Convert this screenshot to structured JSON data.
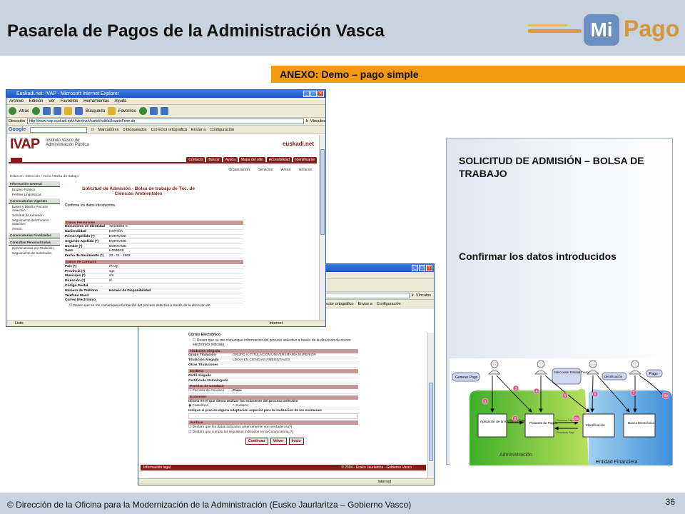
{
  "slide": {
    "title": "Pasarela de Pagos de la Administración Vasca",
    "logo": {
      "mi": "Mi",
      "pago": "Pago"
    },
    "annex": "ANEXO: Demo – pago simple",
    "footer": "© Dirección de la Oficina para la Modernización de la Administración (Eusko Jaurlaritza – Gobierno Vasco)",
    "page_number": "36"
  },
  "panel": {
    "heading": "SOLICITUD DE ADMISIÓN – BOLSA DE TRABAJO",
    "subheading": "Confirmar los datos introducidos"
  },
  "diagram": {
    "roles": [
      "Generar Pago",
      "Seleccionar Entidad Financiera",
      "Identificación",
      "Pago"
    ],
    "nodes": [
      "Aplicación de la Administración",
      "Pasarela de Pagos",
      "Identificación",
      "Banca Electrónica"
    ],
    "steps": [
      "1",
      "2",
      "3",
      "4",
      "5",
      "6",
      "7",
      "8a",
      "8b"
    ],
    "arrows": [
      "Solicitar Pago",
      "Presentar Pago",
      "Resultado Pago"
    ],
    "regions": [
      "Administración",
      "Entidad Financiera"
    ]
  },
  "browser_front": {
    "title": "Euskadi.net: IVAP - Microsoft Internet Explorer",
    "menu": [
      "Archivo",
      "Edición",
      "Ver",
      "Favoritos",
      "Herramientas",
      "Ayuda"
    ],
    "toolbar": [
      "Atrás",
      "Búsqueda",
      "Favoritos"
    ],
    "address_label": "Dirección",
    "address": "http://www.ivap.euskadi.net/r/ivtrebvr/r/cartel/validaUsuarioForm.do",
    "go": "Ir",
    "links": "Vínculos",
    "google_items": [
      "Google",
      "Ir",
      "Marcadores",
      "0 bloqueados",
      "Corrector ortográfico",
      "Enviar a",
      "Configuración"
    ],
    "org_name": "Instituto Vasco de Administración Pública",
    "org_logo": "IVAP",
    "site_logo": "euskadi.net",
    "nav_tabs": [
      "Contacto",
      "Buscar",
      "Ayuda",
      "Mapa del sitio",
      "Accesibilidad",
      "Identificarse"
    ],
    "sub_nav": [
      "Organización",
      "Servicios",
      "Áreas",
      "Enlaces"
    ],
    "breadcrumb": "Estás en: Selección / Inicio / Bolsa de trabajo",
    "sidebar": [
      {
        "head": "Información General",
        "items": [
          "Empleo Público",
          "Perfiles Lingüísticos"
        ]
      },
      {
        "head": "Convocatorias Vigentes",
        "items": [
          "Bases y Diseño Proceso Selectivo",
          "Solicitud de Admisión",
          "Seguimiento del Proceso Selectivo",
          "Avisos"
        ]
      },
      {
        "head": "Convocatorias Finalizadas",
        "items": []
      },
      {
        "head": "Consultas Personalizadas",
        "items": [
          "Convocatorias por Titulación",
          "Seguimiento de Solicitudes"
        ]
      }
    ],
    "form_title": "Solicitud de Admisión - Bolsa de trabajo de Téc. de Ciencias Ambientales",
    "confirm": "Confirme los datos introducidos.",
    "sections": [
      {
        "name": "Datos Personales",
        "rows": [
          [
            "Documento de Identidad",
            "72436950 S"
          ],
          [
            "Nacionalidad",
            "ESPAÑA"
          ],
          [
            "Primer Apellido (*)",
            "BORRAME"
          ],
          [
            "Segundo Apellido (*)",
            "BORRAME"
          ],
          [
            "Nombre (*)",
            "BORRAME"
          ],
          [
            "Sexo",
            "HOMBRE"
          ],
          [
            "Fecha de Nacimiento (*)",
            "22 - 11 - 1962"
          ]
        ]
      },
      {
        "name": "Datos de Contacto",
        "rows": [
          [
            "País (*)",
            "IRAQ"
          ],
          [
            "Provincia (*)",
            "sgs"
          ],
          [
            "Municipio (*)",
            "sfs"
          ],
          [
            "Dirección (*)",
            "sf"
          ],
          [
            "Código Postal",
            ""
          ],
          [
            "Número de Teléfono",
            "Horario de Disponibilidad"
          ],
          [
            "Teléfono Movil",
            ""
          ],
          [
            "Correo Electrónico",
            ""
          ]
        ]
      }
    ],
    "checkbox_text": "Deseo que se me comunique información del proceso selectivo a través de la dirección de",
    "status": "Listo",
    "zone": "Internet"
  },
  "browser_back": {
    "google_items": [
      "rector ortográfico",
      "Enviar a",
      "Configuración"
    ],
    "go": "Ir",
    "links": "Vínculos",
    "rows": [
      {
        "type": "label",
        "text": "Correo Electrónico"
      },
      {
        "type": "check",
        "text": "Deseo que se me comunique información del proceso selectivo a través de la dirección de correo electrónico indicada"
      },
      {
        "type": "section",
        "text": "Titulación Alegada"
      },
      {
        "type": "kv",
        "k": "Grupo Titulación",
        "v": "GRUPO A: TITULACIÓN UNIVERSITARIA SUPERIOR"
      },
      {
        "type": "kv",
        "k": "Titulación Alegada",
        "v": "LDO/A EN CIENCIAS AMBIENTALES"
      },
      {
        "type": "kv",
        "k": "Otras Titulaciones",
        "v": ""
      },
      {
        "type": "section",
        "text": "Euskera"
      },
      {
        "type": "kv",
        "k": "Perfil Alegado",
        "v": ""
      },
      {
        "type": "kv",
        "k": "Certificado Homologado",
        "v": ""
      },
      {
        "type": "section",
        "text": "Permiso de Conducir"
      },
      {
        "type": "kv",
        "k": "Permiso de Conducir",
        "v": "Clase"
      },
      {
        "type": "section",
        "text": "Exámenes"
      },
      {
        "type": "label",
        "text": "Idioma en el que desea realizar los exámenes del proceso selectivo"
      },
      {
        "type": "kv",
        "k": "Castellano",
        "v": "Euskera"
      },
      {
        "type": "label",
        "text": "Indique si precisa alguna adaptación especial para la realización de los exámenes"
      },
      {
        "type": "section",
        "text": "Verificar"
      },
      {
        "type": "check",
        "text": "Declaro que los datos indicados anteriormente son verdaderos.(*)"
      },
      {
        "type": "check",
        "text": "Declaro que cumplo los requisitos indicados en la Convocatoria.(*)"
      }
    ],
    "buttons": [
      "Continuar",
      "Volver",
      "Inicio"
    ],
    "legal": "Información legal",
    "copyright": "© 2004 - Eusko Jaurlaritza - Gobierno Vasco",
    "zone": "Internet"
  }
}
